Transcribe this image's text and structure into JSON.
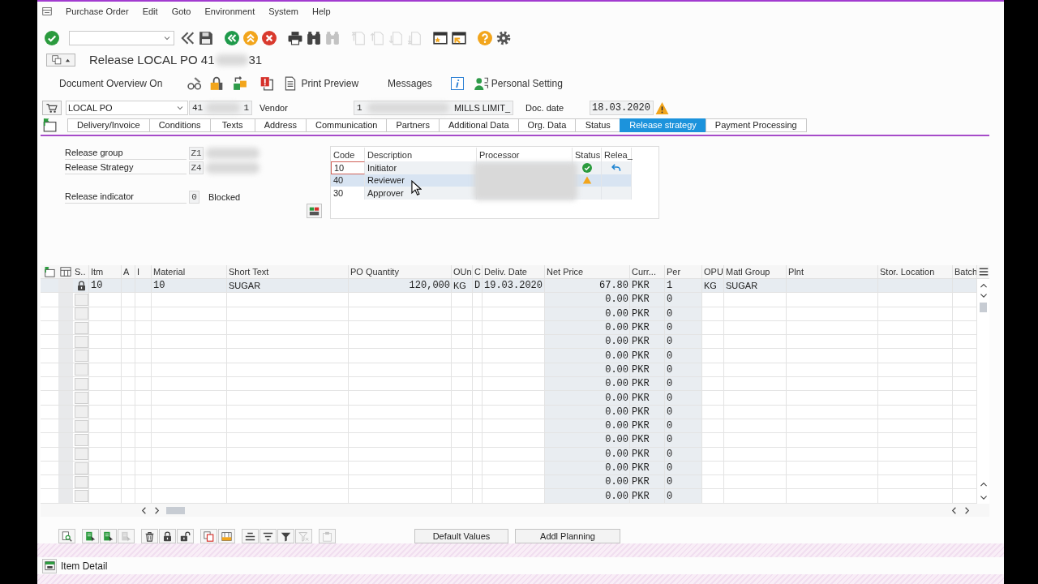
{
  "menu_bar": {
    "items": [
      "Purchase Order",
      "Edit",
      "Goto",
      "Environment",
      "System",
      "Help"
    ]
  },
  "standard_toolbar": {
    "groups": [
      {
        "buttons": [
          {
            "disabled": false
          }
        ]
      },
      {
        "buttons": [
          {
            "disabled": false
          },
          {
            "disabled": false
          }
        ]
      },
      {
        "buttons": [
          {
            "disabled": false
          },
          {
            "disabled": false
          },
          {
            "disabled": false
          }
        ]
      },
      {
        "buttons": [
          {
            "disabled": false
          },
          {
            "disabled": false
          },
          {
            "disabled": true
          }
        ]
      },
      {
        "buttons": [
          {
            "disabled": true
          },
          {
            "disabled": true
          },
          {
            "disabled": true
          },
          {
            "disabled": true
          }
        ]
      },
      {
        "buttons": [
          {
            "disabled": false
          },
          {
            "disabled": false
          }
        ]
      },
      {
        "buttons": [
          {
            "disabled": false
          },
          {
            "disabled": false
          }
        ]
      }
    ]
  },
  "title_bar": {
    "title": "Release LOCAL PO 41",
    "title_end": "31"
  },
  "application_toolbar": {
    "document_overview": "Document Overview On",
    "print_preview": "Print Preview",
    "messages": "Messages",
    "personal_setting": "Personal Setting"
  },
  "header": {
    "document_type": "LOCAL PO",
    "po_number_start": "41",
    "po_number_end": "1",
    "vendor_label": "Vendor",
    "vendor_number": "1",
    "vendor_name": "MILLS LIMIT_",
    "doc_date_label": "Doc. date",
    "doc_date": "18.03.2020"
  },
  "tabs": [
    {
      "label": "Delivery/Invoice",
      "selected": false
    },
    {
      "label": "Conditions",
      "selected": false
    },
    {
      "label": "Texts",
      "selected": false
    },
    {
      "label": "Address",
      "selected": false
    },
    {
      "label": "Communication",
      "selected": false
    },
    {
      "label": "Partners",
      "selected": false
    },
    {
      "label": "Additional Data",
      "selected": false
    },
    {
      "label": "Org. Data",
      "selected": false
    },
    {
      "label": "Status",
      "selected": false
    },
    {
      "label": "Release strategy",
      "selected": true
    },
    {
      "label": "Payment Processing",
      "selected": false
    }
  ],
  "release": {
    "fields": [
      {
        "label": "Release group",
        "value": "Z1"
      },
      {
        "label": "Release Strategy",
        "value": "Z4"
      }
    ],
    "indicator": {
      "label": "Release indicator",
      "value": "0",
      "text": "Blocked"
    },
    "table": {
      "columns": [
        "Code",
        "Description",
        "Processor",
        "Status",
        "Relea_"
      ],
      "rows": [
        {
          "code": "10",
          "description": "Initiator",
          "released": true,
          "awaiting": false,
          "reset_option": true,
          "selected": false,
          "focused": true
        },
        {
          "code": "40",
          "description": "Reviewer",
          "released": false,
          "awaiting": true,
          "reset_option": false,
          "selected": true,
          "focused": false
        },
        {
          "code": "30",
          "description": "Approver",
          "released": false,
          "awaiting": false,
          "reset_option": false,
          "selected": false,
          "focused": false
        }
      ]
    }
  },
  "items_table": {
    "columns": [
      "S..",
      "Itm",
      "A",
      "I",
      "Material",
      "Short Text",
      "PO Quantity",
      "OUn",
      "C",
      "Deliv. Date",
      "Net Price",
      "Curr...",
      "Per",
      "OPU",
      "Matl Group",
      "Plnt",
      "Stor. Location",
      "Batch"
    ],
    "rows": [
      {
        "locked": true,
        "itm": "10",
        "material": "10",
        "short_text": "SUGAR",
        "po_quantity": "120,000",
        "oun": "KG",
        "c": "D",
        "deliv_date": "19.03.2020",
        "net_price": "67.80",
        "curr": "PKR",
        "per": "1",
        "opu": "KG",
        "matl_group": "SUGAR"
      },
      {
        "locked": false,
        "net_price": "0.00",
        "curr": "PKR",
        "per": "0"
      },
      {
        "locked": false,
        "net_price": "0.00",
        "curr": "PKR",
        "per": "0"
      },
      {
        "locked": false,
        "net_price": "0.00",
        "curr": "PKR",
        "per": "0"
      },
      {
        "locked": false,
        "net_price": "0.00",
        "curr": "PKR",
        "per": "0"
      },
      {
        "locked": false,
        "net_price": "0.00",
        "curr": "PKR",
        "per": "0"
      },
      {
        "locked": false,
        "net_price": "0.00",
        "curr": "PKR",
        "per": "0"
      },
      {
        "locked": false,
        "net_price": "0.00",
        "curr": "PKR",
        "per": "0"
      },
      {
        "locked": false,
        "net_price": "0.00",
        "curr": "PKR",
        "per": "0"
      },
      {
        "locked": false,
        "net_price": "0.00",
        "curr": "PKR",
        "per": "0"
      },
      {
        "locked": false,
        "net_price": "0.00",
        "curr": "PKR",
        "per": "0"
      },
      {
        "locked": false,
        "net_price": "0.00",
        "curr": "PKR",
        "per": "0"
      },
      {
        "locked": false,
        "net_price": "0.00",
        "curr": "PKR",
        "per": "0"
      },
      {
        "locked": false,
        "net_price": "0.00",
        "curr": "PKR",
        "per": "0"
      },
      {
        "locked": false,
        "net_price": "0.00",
        "curr": "PKR",
        "per": "0"
      },
      {
        "locked": false,
        "net_price": "0.00",
        "curr": "PKR",
        "per": "0"
      }
    ]
  },
  "bottom_toolbar": {
    "groups": [
      {
        "buttons": [
          {
            "disabled": false
          }
        ]
      },
      {
        "buttons": [
          {
            "disabled": false
          },
          {
            "disabled": false
          },
          {
            "disabled": true
          }
        ]
      },
      {
        "buttons": [
          {
            "disabled": false
          },
          {
            "disabled": false
          },
          {
            "disabled": false
          }
        ]
      },
      {
        "buttons": [
          {
            "disabled": false
          },
          {
            "disabled": false
          }
        ]
      },
      {
        "buttons": [
          {
            "disabled": false
          },
          {
            "disabled": false
          },
          {
            "disabled": false
          },
          {
            "disabled": true
          }
        ]
      },
      {
        "buttons": [
          {
            "disabled": true
          }
        ]
      }
    ],
    "buttons": [
      "Default Values",
      "Addl Planning"
    ]
  },
  "footer": {
    "item_detail": "Item Detail"
  }
}
